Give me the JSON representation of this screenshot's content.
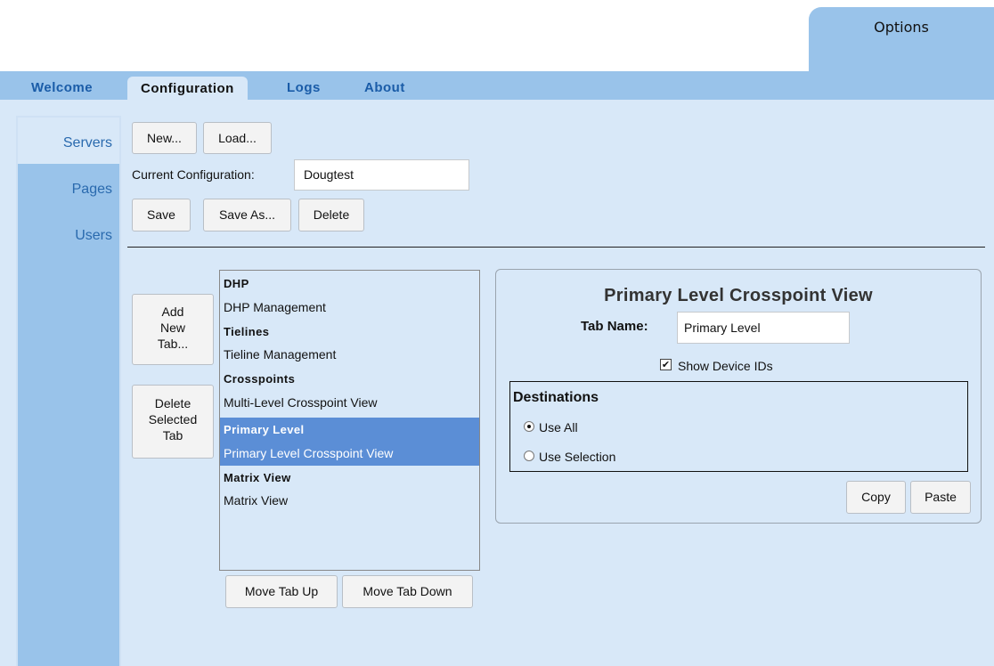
{
  "options_tab": {
    "label": "Options"
  },
  "main_tabs": [
    {
      "label": "Welcome"
    },
    {
      "label": "Configuration"
    },
    {
      "label": "Logs"
    },
    {
      "label": "About"
    }
  ],
  "left_nav": {
    "items": [
      {
        "label": "Servers"
      },
      {
        "label": "Pages",
        "selected": true
      },
      {
        "label": "Users"
      }
    ]
  },
  "config": {
    "new_label": "New...",
    "load_label": "Load...",
    "current_label": "Current Configuration:",
    "current_value": "Dougtest",
    "save_label": "Save",
    "save_as_label": "Save As...",
    "delete_label": "Delete"
  },
  "tab_actions": {
    "add_line1": "Add",
    "add_line2": "New",
    "add_line3": "Tab...",
    "delete_line1": "Delete",
    "delete_line2": "Selected",
    "delete_line3": "Tab",
    "move_up": "Move Tab Up",
    "move_down": "Move Tab Down"
  },
  "tab_list": [
    {
      "group": "DHP",
      "view": "DHP Management"
    },
    {
      "group": "Tielines",
      "view": "Tieline Management"
    },
    {
      "group": "Crosspoints",
      "view": "Multi-Level Crosspoint View"
    },
    {
      "group": "Primary Level",
      "view": "Primary Level Crosspoint View",
      "selected": true
    },
    {
      "group": "Matrix View",
      "view": "Matrix View"
    }
  ],
  "panel": {
    "title": "Primary Level Crosspoint View",
    "tab_name_label": "Tab Name:",
    "tab_name_value": "Primary Level",
    "show_ids_label": "Show Device IDs",
    "show_ids_checked": true,
    "destinations_label": "Destinations",
    "use_all_label": "Use All",
    "use_selection_label": "Use Selection",
    "destination_mode": "Use All",
    "copy_label": "Copy",
    "paste_label": "Paste",
    "check_glyph": "✔"
  }
}
